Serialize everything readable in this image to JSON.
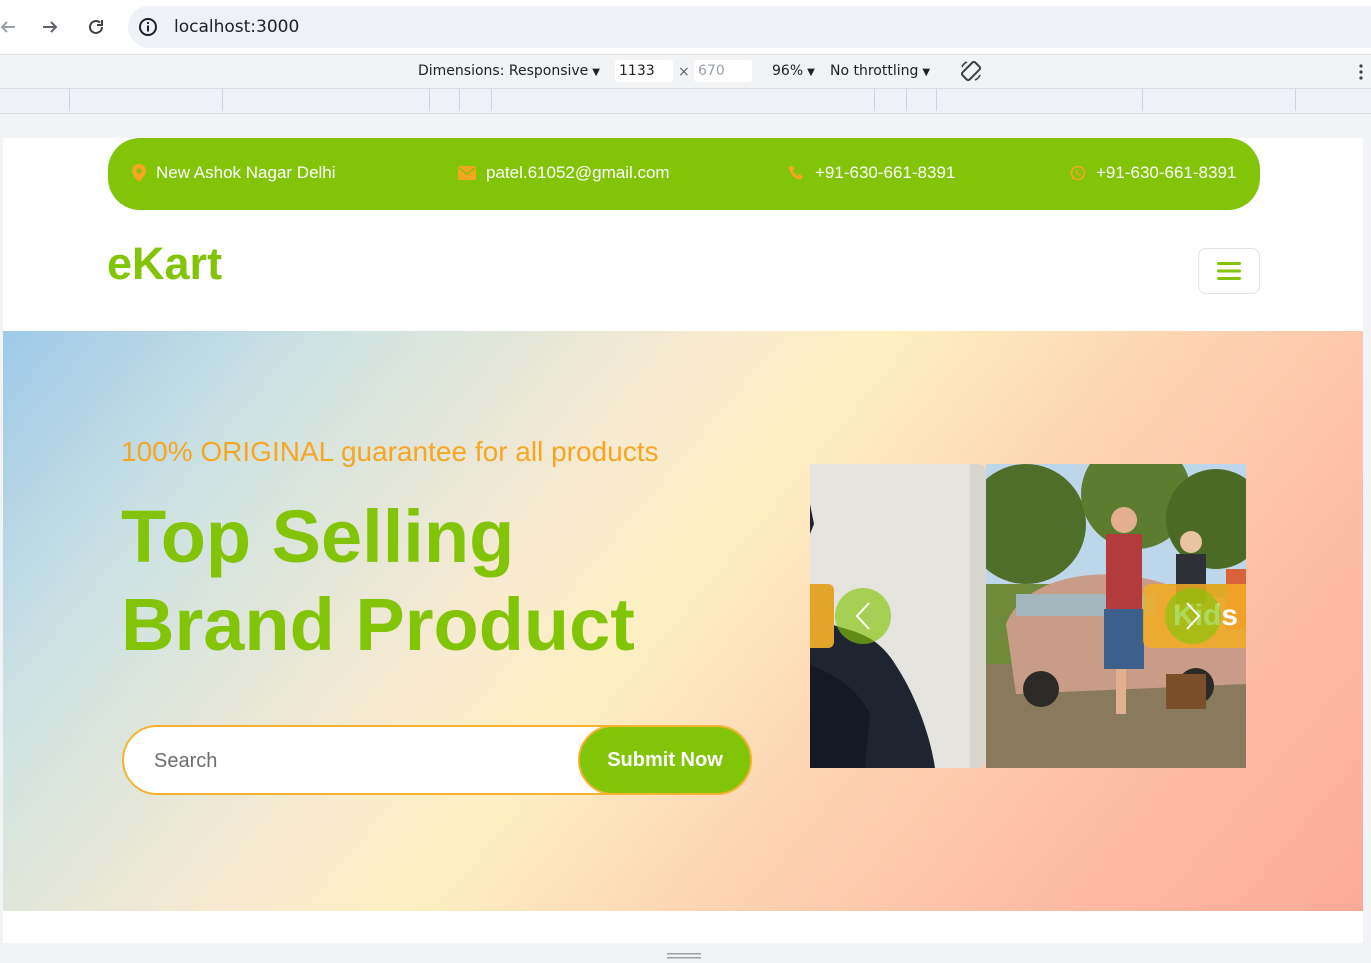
{
  "browser": {
    "url": "localhost:3000"
  },
  "device_toolbar": {
    "dimensions_label": "Dimensions: Responsive",
    "width": "1133",
    "height": "670",
    "zoom": "96%",
    "throttling": "No throttling"
  },
  "site": {
    "contact": {
      "address": "New Ashok Nagar Delhi",
      "email": "patel.61052@gmail.com",
      "phone": "+91-630-661-8391",
      "whatsapp": "+91-630-661-8391"
    },
    "logo": "eKart",
    "hero": {
      "tagline": "100% ORIGINAL guarantee for all products",
      "title_line1": "Top Selling",
      "title_line2": "Brand Product",
      "search_placeholder": "Search",
      "submit_label": "Submit Now",
      "carousel_label": "Kids"
    }
  },
  "colors": {
    "brand_green": "#82c408",
    "accent_orange": "#f6a623"
  }
}
